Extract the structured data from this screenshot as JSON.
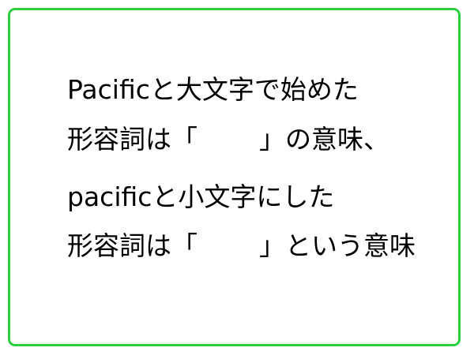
{
  "card": {
    "border_color": "#2ecc40",
    "line1": "Pacificと大文字で始めた",
    "line2_prefix": "形容詞は「",
    "line2_suffix": "」の意味、",
    "line3": "pacificと小文字にした",
    "line4_prefix": "形容詞は「",
    "line4_suffix": "」という意味"
  }
}
